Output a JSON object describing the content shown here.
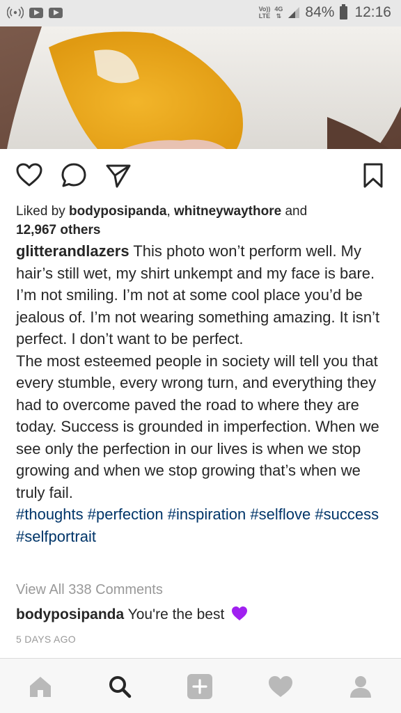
{
  "status_bar": {
    "volte_top": "Vo))",
    "volte_bottom": "LTE",
    "network": "4G",
    "battery": "84%",
    "time": "12:16"
  },
  "post": {
    "liked_by_prefix": "Liked by ",
    "liked_user_1": "bodyposipanda",
    "liked_separator": ", ",
    "liked_user_2": "whitneywaythore",
    "liked_and": " and",
    "liked_others": "12,967 others",
    "caption_user": "glitterandlazers",
    "caption_p1": " This photo won’t perform well. My hair’s still wet, my shirt unkempt and my face is bare. I’m not smiling. I’m not at some cool place you’d be jealous of. I’m not wearing something amazing.  It isn’t perfect. I don’t want to be perfect.",
    "caption_p2": "The most esteemed people in society will tell you that every stumble, every wrong turn, and everything they had to overcome paved the road to where they are today. Success is grounded in imperfection.  When we see only the perfection in our lives is when we stop growing and when we stop growing that’s when we truly fail.",
    "hashtags": [
      "#thoughts",
      "#perfection",
      "#inspiration",
      "#selflove",
      "#success",
      "#selfportrait"
    ],
    "view_all_comments": "View All 338 Comments",
    "comment_user": "bodyposipanda",
    "comment_text": " You're the best",
    "timestamp": "5 DAYS AGO"
  },
  "icons": {
    "like": "heart-outline-icon",
    "comment": "speech-bubble-icon",
    "share": "paper-plane-icon",
    "save": "bookmark-icon",
    "emoji": "purple-heart-emoji"
  },
  "nav": [
    "home",
    "search",
    "add",
    "activity",
    "profile"
  ],
  "colors": {
    "hashtag": "#003569",
    "muted": "#999999",
    "text": "#262626",
    "emoji_heart": "#a020f0"
  }
}
